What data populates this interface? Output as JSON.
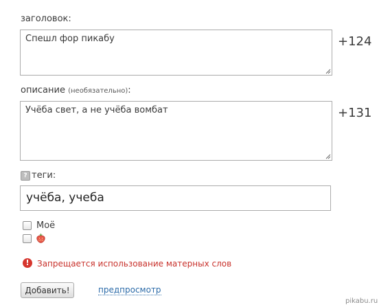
{
  "form": {
    "title_label": "заголовок:",
    "title_value": "Спешл фор пикабу",
    "title_counter": "+124",
    "description_label": "описание",
    "description_optional": "(необязательно)",
    "description_colon": ":",
    "description_value": "Учёба свет, а не учёба вомбат",
    "description_counter": "+131",
    "tags_help_icon": "?",
    "tags_label": "теги:",
    "tags_value": "учёба, учеба",
    "checkbox_mine_label": "Моё",
    "checkbox_strawberry_icon": "strawberry-icon",
    "error_text": "Запрещается использование матерных слов",
    "submit_label": "Добавить!",
    "preview_label": "предпросмотр"
  },
  "watermark": "pikabu.ru",
  "colors": {
    "error": "#c8302a",
    "link": "#2a6aa8",
    "border": "#aaaaaa"
  }
}
